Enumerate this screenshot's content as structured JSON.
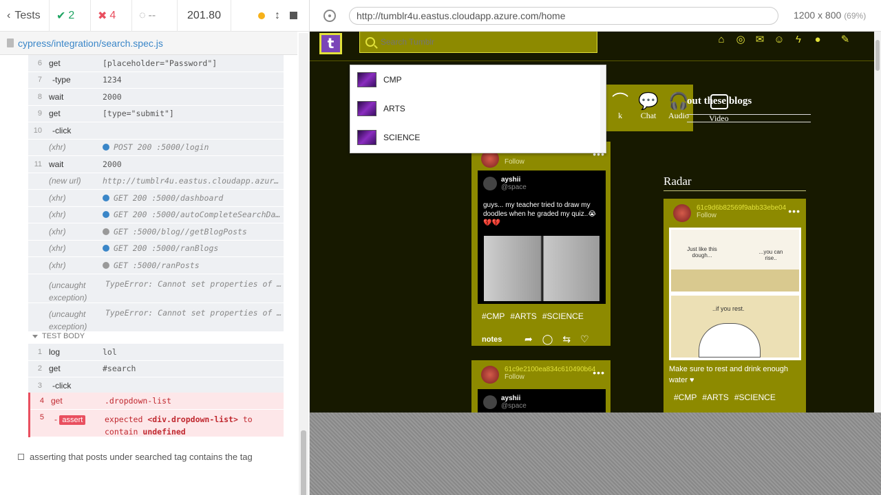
{
  "reporter": {
    "tests_label": "Tests",
    "passed": "2",
    "failed": "4",
    "pending": "--",
    "duration": "201.80",
    "spec_path": "cypress/integration/search.spec.js"
  },
  "hooks_cmds": [
    {
      "n": "6",
      "name": "get",
      "msg": "[placeholder=\"Password\"]",
      "type": "cmd"
    },
    {
      "n": "7",
      "name": "-type",
      "msg": "1234",
      "type": "sub"
    },
    {
      "n": "8",
      "name": "wait",
      "msg": "2000",
      "type": "cmd"
    },
    {
      "n": "9",
      "name": "get",
      "msg": "[type=\"submit\"]",
      "type": "cmd"
    },
    {
      "n": "10",
      "name": "-click",
      "msg": "",
      "type": "sub"
    },
    {
      "n": "",
      "name": "(xhr)",
      "msg": "POST 200 :5000/login",
      "type": "ev",
      "dot": "#3a86c8"
    },
    {
      "n": "11",
      "name": "wait",
      "msg": "2000",
      "type": "cmd"
    },
    {
      "n": "",
      "name": "(new url)",
      "msg": "http://tumblr4u.eastus.cloudapp.azure...",
      "type": "ev"
    },
    {
      "n": "",
      "name": "(xhr)",
      "msg": "GET 200 :5000/dashboard",
      "type": "ev",
      "dot": "#3a86c8"
    },
    {
      "n": "",
      "name": "(xhr)",
      "msg": "GET 200 :5000/autoCompleteSearchDa...",
      "type": "ev",
      "dot": "#3a86c8"
    },
    {
      "n": "",
      "name": "(xhr)",
      "msg": "GET :5000/blog//getBlogPosts",
      "type": "ev",
      "dot": "#999999"
    },
    {
      "n": "",
      "name": "(xhr)",
      "msg": "GET 200 :5000/ranBlogs",
      "type": "ev",
      "dot": "#3a86c8"
    },
    {
      "n": "",
      "name": "(xhr)",
      "msg": "GET :5000/ranPosts",
      "type": "ev",
      "dot": "#999999"
    }
  ],
  "exceptions": [
    {
      "name": "(uncaught exception)",
      "msg": "TypeError: Cannot set properties of u..."
    },
    {
      "name": "(uncaught exception)",
      "msg": "TypeError: Cannot set properties of u..."
    }
  ],
  "test_body_label": "TEST BODY",
  "body_cmds": [
    {
      "n": "1",
      "name": "log",
      "msg": "lol",
      "type": "cmd"
    },
    {
      "n": "2",
      "name": "get",
      "msg": "#search",
      "type": "cmd"
    },
    {
      "n": "3",
      "name": "-click",
      "msg": "",
      "type": "sub"
    }
  ],
  "error_cmds": {
    "get_n": "4",
    "get_name": "get",
    "get_msg": ".dropdown-list",
    "assert_n": "5",
    "assert_label": "assert",
    "assert_msg_1": "expected",
    "assert_msg_el": "<div.dropdown-list>",
    "assert_msg_2": "to",
    "assert_msg_3": "contain",
    "assert_msg_4": "undefined"
  },
  "next_test": "asserting that posts under searched tag contains the tag",
  "browser": {
    "url": "http://tumblr4u.eastus.cloudapp.azure.com/home",
    "viewport": "1200 x 800",
    "zoom": "(69%)"
  },
  "app": {
    "logo": "t",
    "search_placeholder": "Search Tumblr",
    "dropdown": [
      "CMP",
      "ARTS",
      "SCIENCE"
    ],
    "tabs": [
      {
        "label": "k",
        "icon": "⌒"
      },
      {
        "label": "Chat",
        "icon": "💬"
      },
      {
        "label": "Audio",
        "icon": "🎧"
      }
    ],
    "about_text": "out these blogs",
    "video_label": "Video",
    "post1": {
      "tweet_user": "ayshii",
      "tweet_handle": "@space",
      "tweet_text": "guys... my teacher tried to draw my doodles when he graded my quiz..😭💔💔",
      "tags": [
        "#CMP",
        "#ARTS",
        "#SCIENCE"
      ],
      "notes": "notes",
      "follow": "Follow"
    },
    "post2": {
      "user": "61c9e2100ea834c610490b64",
      "follow": "Follow",
      "tweet_user": "ayshii",
      "tweet_handle": "@space"
    },
    "radar": {
      "title": "Radar",
      "user": "61c9d6b82569f9abb33ebe04",
      "follow": "Follow",
      "comic_text_1": "Just like this dough...",
      "comic_text_2": "...you can rise..",
      "comic_text_3": "..if you rest.",
      "caption": "Make sure to rest and drink enough water ♥",
      "tags": [
        "#CMP",
        "#ARTS",
        "#SCIENCE"
      ]
    }
  }
}
